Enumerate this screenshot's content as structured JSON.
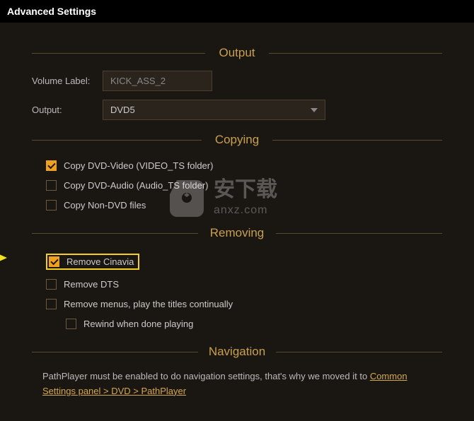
{
  "header": {
    "title": "Advanced Settings"
  },
  "sections": {
    "output": {
      "title": "Output",
      "volumeLabel": "Volume Label:",
      "volumeValue": "KICK_ASS_2",
      "outputLabel": "Output:",
      "outputValue": "DVD5"
    },
    "copying": {
      "title": "Copying",
      "copyVideo": "Copy DVD-Video (VIDEO_TS folder)",
      "copyAudio": "Copy DVD-Audio (Audio_TS folder)",
      "copyNonDvd": "Copy Non-DVD files"
    },
    "removing": {
      "title": "Removing",
      "removeCinavia": "Remove Cinavia",
      "removeDts": "Remove DTS",
      "removeMenus": "Remove menus, play the titles continually",
      "rewind": "Rewind when done playing"
    },
    "navigation": {
      "title": "Navigation",
      "text": "PathPlayer must be enabled to do navigation settings, that's why we moved it to ",
      "linkText": "Common Settings panel > DVD > PathPlayer"
    }
  }
}
